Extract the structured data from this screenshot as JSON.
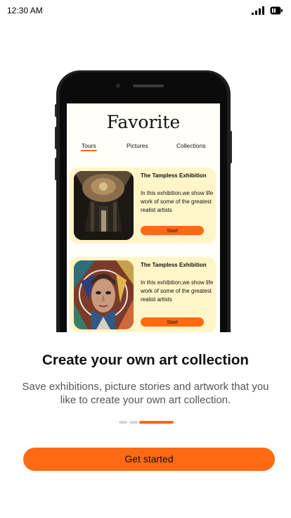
{
  "status_bar": {
    "time": "12:30 AM",
    "icons": [
      "signal-icon",
      "battery-icon"
    ]
  },
  "phone_screen": {
    "title": "Favorite",
    "tabs": [
      {
        "label": "Tours",
        "active": true
      },
      {
        "label": "Pictures",
        "active": false
      },
      {
        "label": "Collections",
        "active": false
      }
    ],
    "cards": [
      {
        "title": "The Tampless Exhibition",
        "description": "In this exhibition,we show life work of some of the greatest realist artists",
        "button_label": "Start",
        "image": "cathedral-ceiling-artwork"
      },
      {
        "title": "The Tampless Exhibition",
        "description": "In this exhibition,we show life work of some of the greatest realist artists",
        "button_label": "Start",
        "image": "geometric-portrait-artwork"
      }
    ]
  },
  "onboarding": {
    "headline": "Create your own art collection",
    "subtext": "Save exhibitions, picture stories and artwork that you like to create your own art collection.",
    "page_indicator": {
      "total": 3,
      "current": 3
    },
    "cta_label": "Get started"
  },
  "colors": {
    "accent": "#ff6a13",
    "card_background": "#fff5c8",
    "screen_background": "#fffef8",
    "text_primary": "#111111",
    "text_secondary": "#555555"
  }
}
